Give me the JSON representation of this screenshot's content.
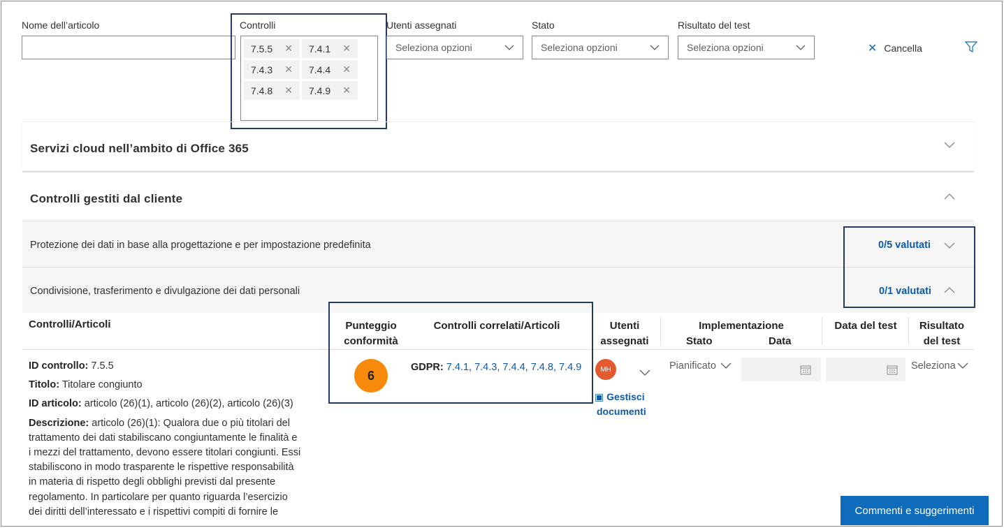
{
  "filters": {
    "article_name_label": "Nome dell’articolo",
    "article_name_value": "",
    "controls_label": "Controlli",
    "controls_tags": [
      "7.5.5",
      "7.4.1",
      "7.4.3",
      "7.4.4",
      "7.4.8",
      "7.4.9"
    ],
    "users_label": "Utenti assegnati",
    "users_placeholder": "Seleziona opzioni",
    "status_label": "Stato",
    "status_placeholder": "Seleziona opzioni",
    "test_result_label": "Risultato del test",
    "test_result_placeholder": "Seleziona opzioni",
    "clear_label": "Cancella"
  },
  "sections": {
    "cloud_services_title": "Servizi cloud nell’ambito di Office 365",
    "customer_controls_title": "Controlli gestiti dal cliente"
  },
  "groups": [
    {
      "title": "Protezione dei dati in base alla progettazione e per impostazione predefinita",
      "assessed": "0/5 valutati"
    },
    {
      "title": "Condivisione, trasferimento e divulgazione dei dati personali",
      "assessed": "0/1 valutati"
    }
  ],
  "table": {
    "headers": {
      "controls_articles": "Controlli/Articoli",
      "compliance_score_1": "Punteggio",
      "compliance_score_2": "conformità",
      "related_controls": "Controlli correlati/Articoli",
      "assigned_users_1": "Utenti",
      "assigned_users_2": "assegnati",
      "implementation": "Implementazione",
      "impl_status": "Stato",
      "impl_date": "Data",
      "test_date": "Data del test",
      "test_result_1": "Risultato",
      "test_result_2": "del test"
    },
    "row": {
      "control_id_label": "ID controllo:",
      "control_id": "7.5.5",
      "title_label": "Titolo:",
      "title": "Titolare congiunto",
      "article_id_label": "ID articolo:",
      "article_id": "articolo (26)(1), articolo (26)(2), articolo (26)(3)",
      "description_label": "Descrizione:",
      "description_lines": [
        "articolo (26)(1): Qualora due o più titolari del",
        "trattamento dei dati stabiliscano congiuntamente le finalità e",
        "i mezzi del trattamento, devono essere titolari congiunti. Essi",
        "stabiliscono in modo trasparente le rispettive responsabilità",
        "in materia di rispetto degli obblighi previsti dal presente",
        "regolamento. In particolare per quanto riguarda l’esercizio",
        "dei diritti dell’interessato e i rispettivi compiti di fornire le"
      ],
      "score": "6",
      "related_prefix": "GDPR:",
      "related_links": [
        "7.4.1",
        "7.4.3",
        "7.4.4",
        "7.4.8",
        "7.4.9"
      ],
      "avatar_initials": "MH",
      "manage_docs_1": "Gestisci",
      "manage_docs_2": "documenti",
      "impl_status_value": "Pianificato",
      "test_result_value": "Seleziona"
    }
  },
  "feedback_button": "Commenti e suggerimenti",
  "colors": {
    "accent_link": "#0f5aa8",
    "primary_button": "#0f6cbd",
    "score_badge": "#f78a0a",
    "avatar": "#e35a2f",
    "highlight_border": "#243a5e"
  }
}
